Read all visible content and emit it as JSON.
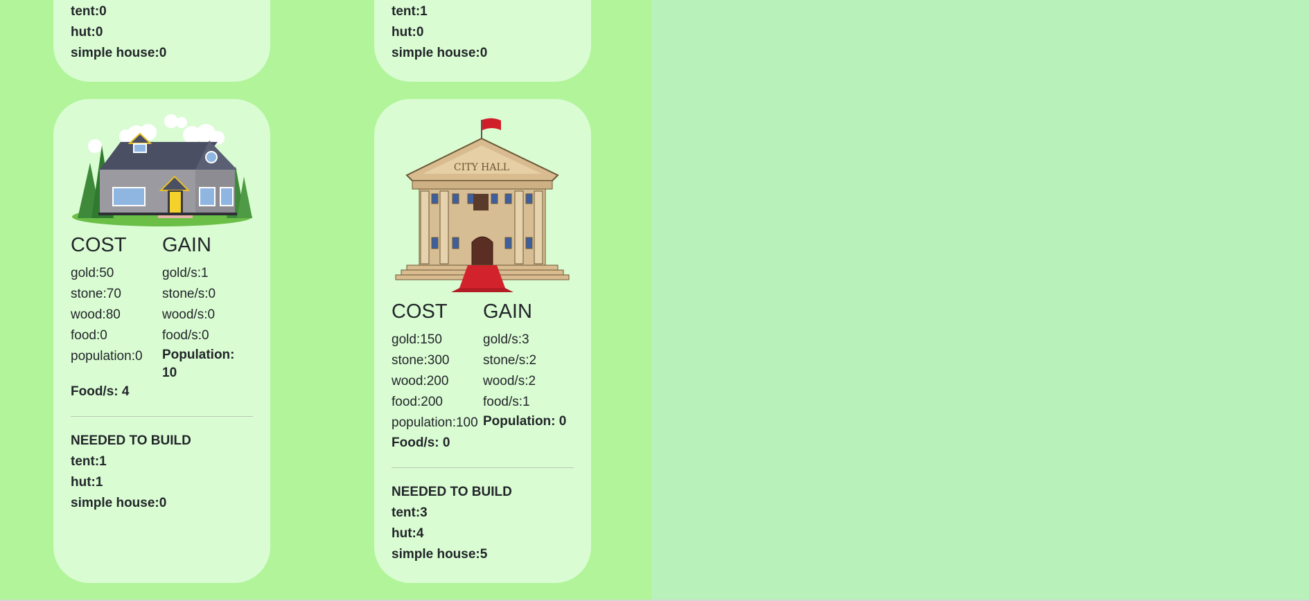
{
  "cards_top": [
    {
      "requirements": [
        {
          "name": "tent",
          "count": 0
        },
        {
          "name": "hut",
          "count": 0
        },
        {
          "name": "simple house",
          "count": 0
        }
      ]
    },
    {
      "requirements": [
        {
          "name": "tent",
          "count": 1
        },
        {
          "name": "hut",
          "count": 0
        },
        {
          "name": "simple house",
          "count": 0
        }
      ]
    }
  ],
  "cards": [
    {
      "image": "house-illustration",
      "cost_title": "COST",
      "gain_title": "GAIN",
      "cost": [
        "gold:50",
        "stone:70",
        "wood:80",
        "food:0",
        "population:0"
      ],
      "gain": [
        "gold/s:1",
        "stone/s:0",
        "wood/s:0",
        "food/s:0"
      ],
      "gain_population": "Population: 10",
      "food_per_s": "Food/s: 4",
      "needed_title": "NEEDED TO BUILD",
      "needed": [
        "tent:1",
        "hut:1",
        "simple house:0"
      ]
    },
    {
      "image": "city-hall-illustration",
      "image_text": "CITY HALL",
      "cost_title": "COST",
      "gain_title": "GAIN",
      "cost": [
        "gold:150",
        "stone:300",
        "wood:200",
        "food:200",
        "population:100"
      ],
      "gain": [
        "gold/s:3",
        "stone/s:2",
        "wood/s:2",
        "food/s:1"
      ],
      "gain_population": "Population: 0",
      "food_per_s": "Food/s: 0",
      "needed_title": "NEEDED TO BUILD",
      "needed": [
        "tent:3",
        "hut:4",
        "simple house:5"
      ]
    }
  ],
  "colors": {
    "left_panel_bg": "#b1f49a",
    "right_bg": "#b9f1bb",
    "card_bg": "#dafcd3"
  }
}
